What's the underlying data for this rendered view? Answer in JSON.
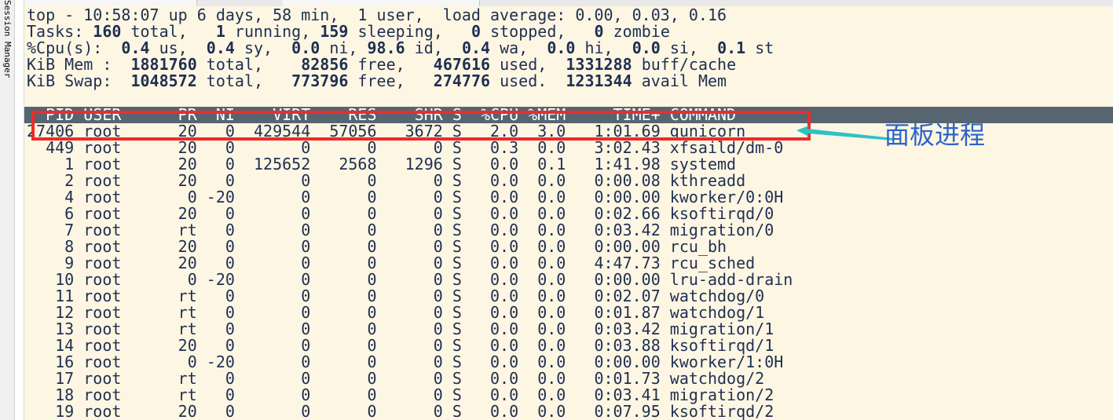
{
  "sidebar": {
    "session_manager_label": "Session Manager"
  },
  "colors": {
    "terminal_bg": "#fdf6e3",
    "terminal_text": "#1f2f52",
    "header_bg": "#566570",
    "highlight": "#ee2b2b",
    "arrow": "#2fc2c4",
    "annotation": "#2e63c9"
  },
  "summary": {
    "uptime": "top - 10:58:07 up 6 days, 58 min,  1 user,  load average: 0.00, 0.03, 0.16",
    "tasks": {
      "prefix": "Tasks: ",
      "total": "160",
      "t1": " total,   ",
      "running": "1",
      "t2": " running, ",
      "sleeping": "159",
      "t3": " sleeping,   ",
      "stopped": "0",
      "t4": " stopped,   ",
      "zombie": "0",
      "t5": " zombie"
    },
    "cpu": {
      "prefix": "%Cpu(s):  ",
      "us": "0.4",
      "t1": " us,  ",
      "sy": "0.4",
      "t2": " sy,  ",
      "ni": "0.0",
      "t3": " ni, ",
      "id": "98.6",
      "t4": " id,  ",
      "wa": "0.4",
      "t5": " wa,  ",
      "hi": "0.0",
      "t6": " hi,  ",
      "si": "0.0",
      "t7": " si,  ",
      "st": "0.1",
      "t8": " st"
    },
    "mem": {
      "prefix": "KiB Mem :  ",
      "total": "1881760",
      "t1": " total,    ",
      "free": "82856",
      "t2": " free,   ",
      "used": "467616",
      "t3": " used,  ",
      "buff": "1331288",
      "t4": " buff/cache"
    },
    "swap": {
      "prefix": "KiB Swap:  ",
      "total": "1048572",
      "t1": " total,   ",
      "free": "773796",
      "t2": " free,   ",
      "used": "274776",
      "t3": " used.  ",
      "avail": "1231344",
      "t4": " avail Mem"
    }
  },
  "process_table": {
    "header": "  PID USER      PR  NI    VIRT    RES    SHR S  %CPU %MEM     TIME+ COMMAND",
    "rows": [
      "27406 root      20   0  429544  57056   3672 S   2.0  3.0   1:01.69 gunicorn",
      "  449 root      20   0       0      0      0 S   0.3  0.0   3:02.43 xfsaild/dm-0",
      "    1 root      20   0  125652   2568   1296 S   0.0  0.1   1:41.98 systemd",
      "    2 root      20   0       0      0      0 S   0.0  0.0   0:00.08 kthreadd",
      "    4 root       0 -20       0      0      0 S   0.0  0.0   0:00.00 kworker/0:0H",
      "    6 root      20   0       0      0      0 S   0.0  0.0   0:02.66 ksoftirqd/0",
      "    7 root      rt   0       0      0      0 S   0.0  0.0   0:03.42 migration/0",
      "    8 root      20   0       0      0      0 S   0.0  0.0   0:00.00 rcu_bh",
      "    9 root      20   0       0      0      0 S   0.0  0.0   4:47.73 rcu_sched",
      "   10 root       0 -20       0      0      0 S   0.0  0.0   0:00.00 lru-add-drain",
      "   11 root      rt   0       0      0      0 S   0.0  0.0   0:02.07 watchdog/0",
      "   12 root      rt   0       0      0      0 S   0.0  0.0   0:01.87 watchdog/1",
      "   13 root      rt   0       0      0      0 S   0.0  0.0   0:03.42 migration/1",
      "   14 root      20   0       0      0      0 S   0.0  0.0   0:03.88 ksoftirqd/1",
      "   16 root       0 -20       0      0      0 S   0.0  0.0   0:00.00 kworker/1:0H",
      "   17 root      rt   0       0      0      0 S   0.0  0.0   0:01.73 watchdog/2",
      "   18 root      rt   0       0      0      0 S   0.0  0.0   0:03.41 migration/2",
      "   19 root      20   0       0      0      0 S   0.0  0.0   0:07.95 ksoftirqd/2"
    ]
  },
  "annotation": {
    "label": "面板进程",
    "target_row": 0
  }
}
